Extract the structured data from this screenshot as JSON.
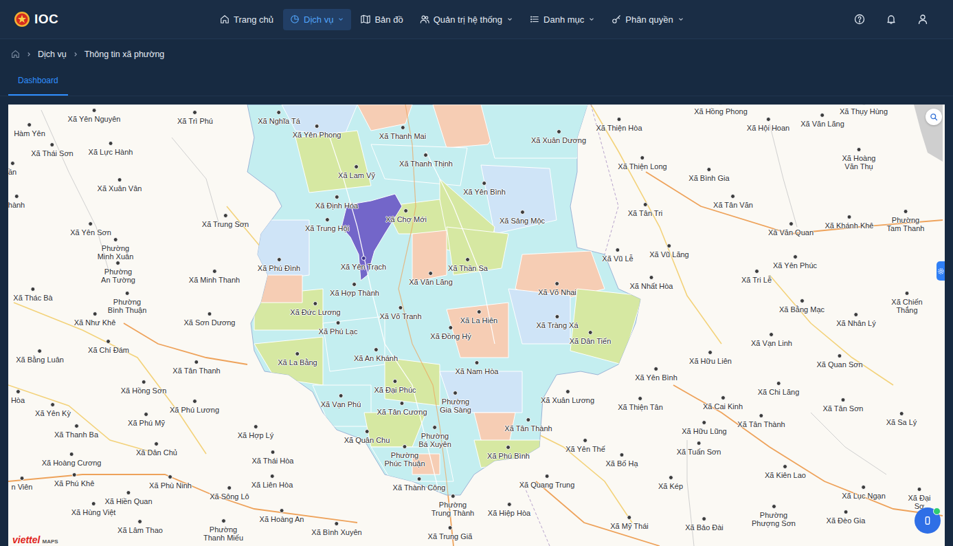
{
  "app": {
    "logo": "IOC"
  },
  "nav": [
    {
      "label": "Trang chủ",
      "selected": false,
      "has_menu": false
    },
    {
      "label": "Dịch vụ",
      "selected": true,
      "has_menu": true
    },
    {
      "label": "Bản đồ",
      "selected": false,
      "has_menu": false
    },
    {
      "label": "Quản trị hệ thống",
      "selected": false,
      "has_menu": true
    },
    {
      "label": "Danh mục",
      "selected": false,
      "has_menu": true
    },
    {
      "label": "Phân quyền",
      "selected": false,
      "has_menu": true
    }
  ],
  "breadcrumb": [
    "Dịch vụ",
    "Thông tin xã phường"
  ],
  "tabs": [
    {
      "label": "Dashboard",
      "selected": true
    }
  ],
  "map": {
    "attribution": {
      "brand": "viettel",
      "product": "MAPS"
    },
    "places": [
      {
        "label": "Xã Yên Nguyên",
        "selected": false
      },
      {
        "label": "Xã Trì Phú",
        "selected": false
      },
      {
        "label": "Hàm Yên",
        "selected": false
      },
      {
        "label": "Xã Thái Sơn",
        "selected": false
      },
      {
        "label": "Xã Lực Hành",
        "selected": false
      },
      {
        "label": "ần",
        "selected": false
      },
      {
        "label": "Xã Xuân Vân",
        "selected": false
      },
      {
        "label": "hành",
        "selected": false
      },
      {
        "label": "Xã Yên Sơn",
        "selected": false
      },
      {
        "label": "Phường\nMinh Xuân",
        "selected": false
      },
      {
        "label": "Phường\nAn Tường",
        "selected": false
      },
      {
        "label": "Xã Trung Sơn",
        "selected": false
      },
      {
        "label": "Xã Minh Thanh",
        "selected": false
      },
      {
        "label": "Xã Thác Bà",
        "selected": false
      },
      {
        "label": "Phường\nBình Thuận",
        "selected": false
      },
      {
        "label": "Xã Như Khê",
        "selected": false
      },
      {
        "label": "Xã Sơn Dương",
        "selected": false
      },
      {
        "label": "Xã Chí Đám",
        "selected": false
      },
      {
        "label": "Xã Bằng Luân",
        "selected": false
      },
      {
        "label": "Xã Tân Thanh",
        "selected": false
      },
      {
        "label": "Xã Hồng Sơn",
        "selected": false
      },
      {
        "label": "Hòa",
        "selected": false
      },
      {
        "label": "Xã Phú Lương",
        "selected": false
      },
      {
        "label": "Xã Yên Kỳ",
        "selected": false
      },
      {
        "label": "Xã Phú Mỹ",
        "selected": false
      },
      {
        "label": "Xã Thanh Ba",
        "selected": false
      },
      {
        "label": "Xã Hợp Lý",
        "selected": false
      },
      {
        "label": "Xã Dân Chủ",
        "selected": false
      },
      {
        "label": "Xã Hoàng Cương",
        "selected": false
      },
      {
        "label": "Xã Thái Hòa",
        "selected": false
      },
      {
        "label": "Xã Phú Khê",
        "selected": false
      },
      {
        "label": "Xã Phù Ninh",
        "selected": false
      },
      {
        "label": "Xã Liên Hòa",
        "selected": false
      },
      {
        "label": "n Viên",
        "selected": false
      },
      {
        "label": "Xã Hiền Quan",
        "selected": false
      },
      {
        "label": "Xã Sông Lô",
        "selected": false
      },
      {
        "label": "Xã Hùng Việt",
        "selected": false
      },
      {
        "label": "Xã Hoàng An",
        "selected": false
      },
      {
        "label": "Xã Lâm Thao",
        "selected": false
      },
      {
        "label": "Phường\nThanh Miếu",
        "selected": false
      },
      {
        "label": "Xã Bình Xuyên",
        "selected": false
      },
      {
        "label": "Xã Trung Giã",
        "selected": false
      },
      {
        "label": "Phường\nTrung Thành",
        "selected": false
      },
      {
        "label": "Xã Hiệp Hòa",
        "selected": false
      },
      {
        "label": "Xã Thành Công",
        "selected": false
      },
      {
        "label": "Phường\nPhúc Thuận",
        "selected": false
      },
      {
        "label": "Phường\nBá Xuyên",
        "selected": false
      },
      {
        "label": "Phường\nGia Sàng",
        "selected": false
      },
      {
        "label": "Xã Nghĩa Tá",
        "selected": false
      },
      {
        "label": "Xã Yên Phong",
        "selected": false
      },
      {
        "label": "Xã Thanh Mai",
        "selected": false
      },
      {
        "label": "Xã Thanh Thịnh",
        "selected": false
      },
      {
        "label": "Xã Lam Vỹ",
        "selected": false
      },
      {
        "label": "Xã Yên Bình",
        "selected": false
      },
      {
        "label": "Xã Định Hóa",
        "selected": false
      },
      {
        "label": "Xã Chợ Mới",
        "selected": false
      },
      {
        "label": "Xã Sảng Mộc",
        "selected": false
      },
      {
        "label": "Xã Trung Hội",
        "selected": false
      },
      {
        "label": "Xã Phú Đình",
        "selected": false
      },
      {
        "label": "Xã Yên Trạch",
        "selected": true
      },
      {
        "label": "Xã Thần Sa",
        "selected": false
      },
      {
        "label": "Xã Văn Lăng",
        "selected": false
      },
      {
        "label": "Xã Hợp Thành",
        "selected": false
      },
      {
        "label": "Xã Võ Nhai",
        "selected": false
      },
      {
        "label": "Xã Đức Lương",
        "selected": false
      },
      {
        "label": "Xã Võ Tranh",
        "selected": false
      },
      {
        "label": "Xã La Hiên",
        "selected": false
      },
      {
        "label": "Xã Tràng Xá",
        "selected": false
      },
      {
        "label": "Xã Phú Lạc",
        "selected": false
      },
      {
        "label": "Xã Đồng Hỷ",
        "selected": false
      },
      {
        "label": "Xã Dân Tiến",
        "selected": false
      },
      {
        "label": "Xã La Bằng",
        "selected": false
      },
      {
        "label": "Xã An Khánh",
        "selected": false
      },
      {
        "label": "Xã Nam Hòa",
        "selected": false
      },
      {
        "label": "Xã Đại Phúc",
        "selected": false
      },
      {
        "label": "Xã Vạn Phú",
        "selected": false
      },
      {
        "label": "Xã Tân Cương",
        "selected": false
      },
      {
        "label": "Xã Xuân Lương",
        "selected": false
      },
      {
        "label": "Xã Tân Thành",
        "selected": false
      },
      {
        "label": "Xã Quân Chu",
        "selected": false
      },
      {
        "label": "Xã Phú Bình",
        "selected": false
      },
      {
        "label": "Xã Yên Thế",
        "selected": false
      },
      {
        "label": "Xã Bố Hạ",
        "selected": false
      },
      {
        "label": "Xã Quang Trung",
        "selected": false
      },
      {
        "label": "Xã Xuân Dương",
        "selected": false
      },
      {
        "label": "Xã Thiện Hòa",
        "selected": false
      },
      {
        "label": "Xã Hồng Phong",
        "selected": false
      },
      {
        "label": "Xã Thụy Hùng",
        "selected": false
      },
      {
        "label": "Xã Hội Hoan",
        "selected": false
      },
      {
        "label": "Xã Văn Lãng",
        "selected": false
      },
      {
        "label": "Xã Hoàng\nVăn Thụ",
        "selected": false
      },
      {
        "label": "Xã Thiện Long",
        "selected": false
      },
      {
        "label": "Xã Bình Gia",
        "selected": false
      },
      {
        "label": "Xã Tân Văn",
        "selected": false
      },
      {
        "label": "Xã Tân Tri",
        "selected": false
      },
      {
        "label": "Phường\nTam Thanh",
        "selected": false
      },
      {
        "label": "Xã Khánh Khê",
        "selected": false
      },
      {
        "label": "Xã Văn Quan",
        "selected": false
      },
      {
        "label": "Xã Vũ Lễ",
        "selected": false
      },
      {
        "label": "Xã Vũ Lăng",
        "selected": false
      },
      {
        "label": "Xã Yên Phúc",
        "selected": false
      },
      {
        "label": "Xã Tri Lễ",
        "selected": false
      },
      {
        "label": "Xã Nhất Hòa",
        "selected": false
      },
      {
        "label": "Xã Chiến Thắng",
        "selected": false
      },
      {
        "label": "Xã Bằng Mạc",
        "selected": false
      },
      {
        "label": "Xã Nhân Lý",
        "selected": false
      },
      {
        "label": "Xã Vạn Linh",
        "selected": false
      },
      {
        "label": "Xã Hữu Liên",
        "selected": false
      },
      {
        "label": "Xã Quan Sơn",
        "selected": false
      },
      {
        "label": "Xã Yên Bình",
        "selected": false
      },
      {
        "label": "Xã Chi Lăng",
        "selected": false
      },
      {
        "label": "Xã Thiện Tân",
        "selected": false
      },
      {
        "label": "Xã Cai Kinh",
        "selected": false
      },
      {
        "label": "Xã Tân Sơn",
        "selected": false
      },
      {
        "label": "Xã Tân Thành",
        "selected": false
      },
      {
        "label": "Xã Sa Lý",
        "selected": false
      },
      {
        "label": "Xã Hữu Lũng",
        "selected": false
      },
      {
        "label": "Xã Tuấn Sơn",
        "selected": false
      },
      {
        "label": "Xã Kiên Lao",
        "selected": false
      },
      {
        "label": "Xã Kép",
        "selected": false
      },
      {
        "label": "Xã Lục Ngạn",
        "selected": false
      },
      {
        "label": "Xã Đại Sơ",
        "selected": false
      },
      {
        "label": "Xã Mỹ Thái",
        "selected": false
      },
      {
        "label": "Xã Bảo Đài",
        "selected": false
      },
      {
        "label": "Phường\nPhượng Sơn",
        "selected": false
      },
      {
        "label": "Xã Đèo Gia",
        "selected": false
      }
    ]
  }
}
